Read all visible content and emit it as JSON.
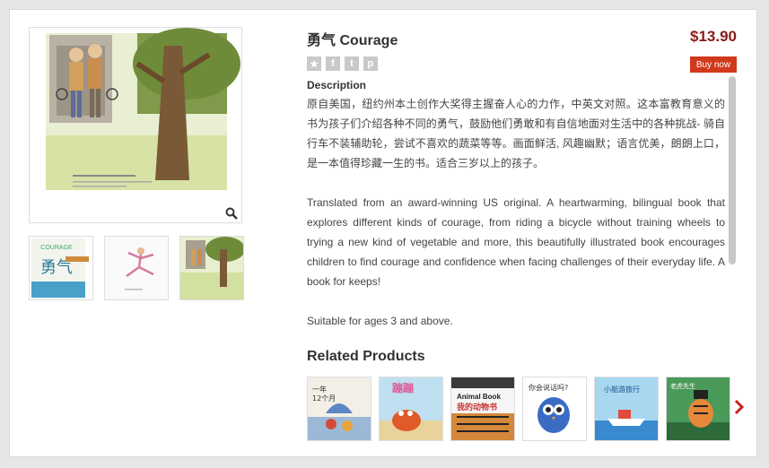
{
  "product": {
    "title": "勇气 Courage",
    "price": "$13.90",
    "buy_label": "Buy now",
    "description_heading": "Description",
    "description_cn": "原自美国，纽约州本土创作大奖得主握奋人心的力作，中英文对照。这本富教育意义的书为孩子们介绍各种不同的勇气，鼓励他们勇敢和有自信地面对生活中的各种挑战- 骑自行车不装辅助轮，尝试不喜欢的蔬菜等等。画面鲜活, 风趣幽默；语言优美，朗朗上口，是一本值得珍藏一生的书。适合三岁以上的孩子。",
    "description_en": "Translated from an award-winning US original. A heartwarming, bilingual book that explores different kinds of courage, from riding a bicycle without training wheels to trying a new kind of vegetable and more, this beautifully illustrated book encourages children to find courage and confidence when facing challenges of their everyday life. A book for keeps!",
    "age_note": "Suitable for ages 3 and above.",
    "image_caption_cn": "勇气，是你第一次骑车不用辅助轮。",
    "image_caption_en": "Courage is riding your bicycle for the first time without training wheels."
  },
  "thumbnails": [
    {
      "cover_title": "COURAGE",
      "cover_cn": "勇气"
    },
    {
      "cover_title": ""
    },
    {
      "cover_title": ""
    }
  ],
  "social_icons": [
    "star-icon",
    "facebook-icon",
    "tumblr-icon",
    "pinterest-icon"
  ],
  "related": {
    "heading": "Related Products",
    "items": [
      {
        "label": "一年12个月"
      },
      {
        "label": "蹦蹦，蹦蹦"
      },
      {
        "label": "Animal Book 我的动物书"
      },
      {
        "label": "你会说话吗？"
      },
      {
        "label": "小船游旅行"
      },
      {
        "label": "老虎先生来撒野"
      }
    ]
  },
  "colors": {
    "price": "#8b1a1a",
    "buy_button": "#d0391b",
    "next_arrow": "#c0271b"
  }
}
